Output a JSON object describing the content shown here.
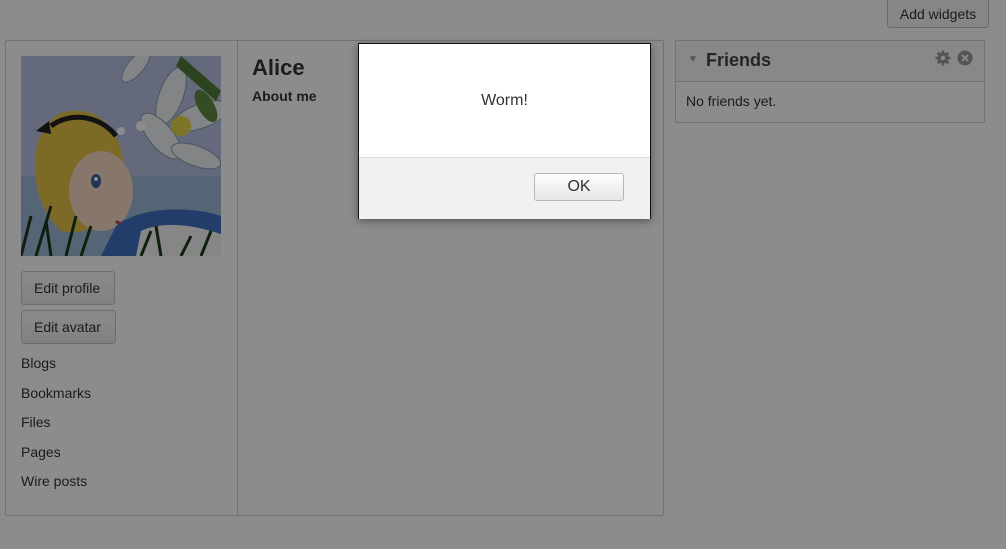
{
  "toolbar": {
    "add_widgets_label": "Add widgets"
  },
  "profile": {
    "name": "Alice",
    "about_label": "About me",
    "edit_profile_label": "Edit profile",
    "edit_avatar_label": "Edit avatar",
    "menu": [
      {
        "label": "Blogs"
      },
      {
        "label": "Bookmarks"
      },
      {
        "label": "Files"
      },
      {
        "label": "Pages"
      },
      {
        "label": "Wire posts"
      }
    ]
  },
  "friends_widget": {
    "title": "Friends",
    "empty_text": "No friends yet.",
    "collapse_icon": "triangle-down",
    "settings_icon": "gear",
    "remove_icon": "close-circle"
  },
  "alert": {
    "message": "Worm!",
    "ok_label": "OK"
  },
  "colors": {
    "overlay": "#000000",
    "page_background": "#ffffff",
    "border": "#cfcfcf"
  }
}
